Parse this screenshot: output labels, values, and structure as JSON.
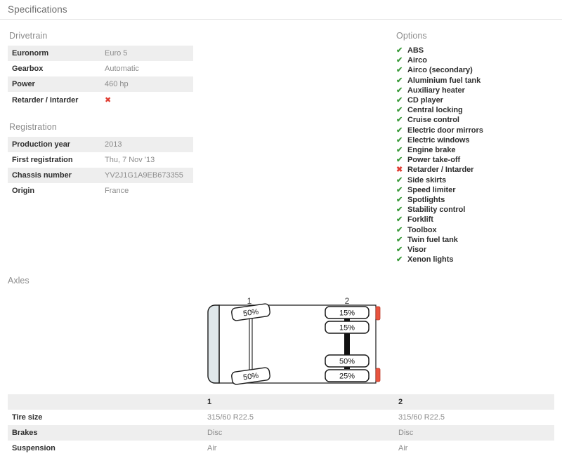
{
  "header": {
    "title": "Specifications"
  },
  "drivetrain": {
    "heading": "Drivetrain",
    "rows": [
      {
        "label": "Euronorm",
        "value": "Euro 5",
        "shaded": true
      },
      {
        "label": "Gearbox",
        "value": "Automatic",
        "shaded": false
      },
      {
        "label": "Power",
        "value": "460 hp",
        "shaded": true
      },
      {
        "label": "Retarder / Intarder",
        "value": "✖",
        "shaded": false,
        "is_mark": true,
        "mark": "no"
      }
    ]
  },
  "registration": {
    "heading": "Registration",
    "rows": [
      {
        "label": "Production year",
        "value": "2013",
        "shaded": true
      },
      {
        "label": "First registration",
        "value": "Thu, 7 Nov '13",
        "shaded": false
      },
      {
        "label": "Chassis number",
        "value": "YV2J1G1A9EB673355",
        "shaded": true
      },
      {
        "label": "Origin",
        "value": "France",
        "shaded": false
      }
    ]
  },
  "options": {
    "heading": "Options",
    "items": [
      {
        "label": "ABS",
        "mark": "yes",
        "glyph": "✔"
      },
      {
        "label": "Airco",
        "mark": "yes",
        "glyph": "✔"
      },
      {
        "label": "Airco (secondary)",
        "mark": "yes",
        "glyph": "✔"
      },
      {
        "label": "Aluminium fuel tank",
        "mark": "yes",
        "glyph": "✔"
      },
      {
        "label": "Auxiliary heater",
        "mark": "yes",
        "glyph": "✔"
      },
      {
        "label": "CD player",
        "mark": "yes",
        "glyph": "✔"
      },
      {
        "label": "Central locking",
        "mark": "yes",
        "glyph": "✔"
      },
      {
        "label": "Cruise control",
        "mark": "yes",
        "glyph": "✔"
      },
      {
        "label": "Electric door mirrors",
        "mark": "yes",
        "glyph": "✔"
      },
      {
        "label": "Electric windows",
        "mark": "yes",
        "glyph": "✔"
      },
      {
        "label": "Engine brake",
        "mark": "yes",
        "glyph": "✔"
      },
      {
        "label": "Power take-off",
        "mark": "yes",
        "glyph": "✔"
      },
      {
        "label": "Retarder / Intarder",
        "mark": "no",
        "glyph": "✖"
      },
      {
        "label": "Side skirts",
        "mark": "yes",
        "glyph": "✔"
      },
      {
        "label": "Speed limiter",
        "mark": "yes",
        "glyph": "✔"
      },
      {
        "label": "Spotlights",
        "mark": "yes",
        "glyph": "✔"
      },
      {
        "label": "Stability control",
        "mark": "yes",
        "glyph": "✔"
      },
      {
        "label": "Forklift",
        "mark": "yes",
        "glyph": "✔"
      },
      {
        "label": "Toolbox",
        "mark": "yes",
        "glyph": "✔"
      },
      {
        "label": "Twin fuel tank",
        "mark": "yes",
        "glyph": "✔"
      },
      {
        "label": "Visor",
        "mark": "yes",
        "glyph": "✔"
      },
      {
        "label": "Xenon lights",
        "mark": "yes",
        "glyph": "✔"
      }
    ]
  },
  "axles": {
    "heading": "Axles",
    "diagram": {
      "axle_numbers": [
        "1",
        "2"
      ],
      "tread_labels": {
        "axle1_top": "50%",
        "axle1_bottom": "50%",
        "axle2_top_outer": "15%",
        "axle2_top_inner": "15%",
        "axle2_bottom_inner": "50%",
        "axle2_bottom_outer": "25%"
      }
    },
    "table": {
      "columns": [
        "",
        "1",
        "2"
      ],
      "rows": [
        {
          "label": "Tire size",
          "values": [
            "315/60 R22.5",
            "315/60 R22.5"
          ],
          "shaded": false
        },
        {
          "label": "Brakes",
          "values": [
            "Disc",
            "Disc"
          ],
          "shaded": true
        },
        {
          "label": "Suspension",
          "values": [
            "Air",
            "Air"
          ],
          "shaded": false
        }
      ]
    }
  },
  "colors": {
    "check_green": "#3b9b3b",
    "cross_red": "#e03c31",
    "row_shade": "#eeeeee",
    "heading_gray": "#8d8d8d",
    "value_gray": "#8c8c8c",
    "marker_red": "#e8543f"
  }
}
